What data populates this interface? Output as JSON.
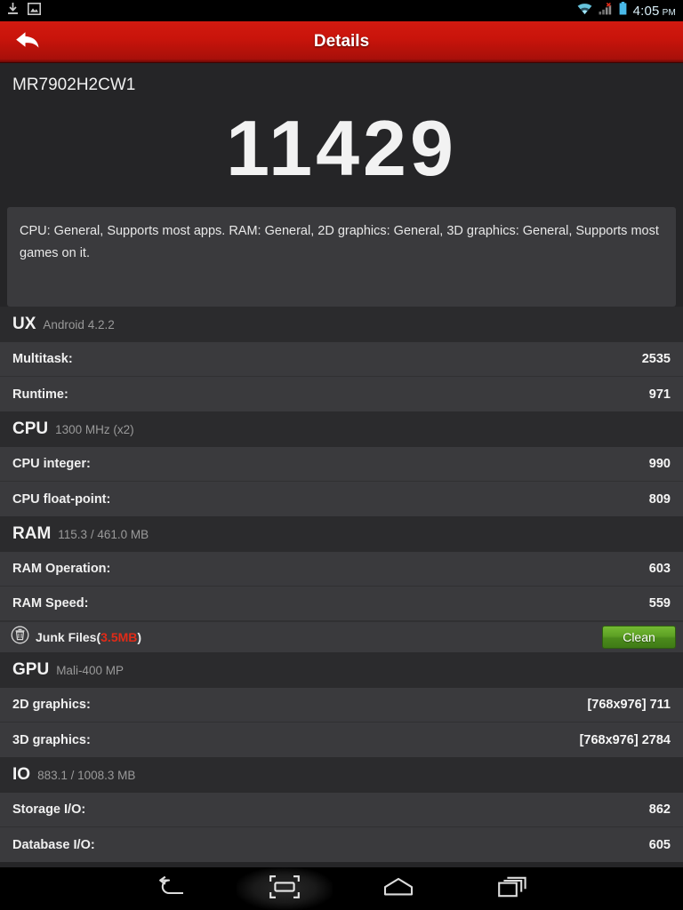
{
  "statusbar": {
    "left_icons": [
      "download-icon",
      "screenshot-image-icon"
    ],
    "right_icons": [
      "wifi-icon",
      "cellular-signal-no-service-icon",
      "battery-icon"
    ],
    "time": "4:05",
    "ampm": "PM"
  },
  "actionbar": {
    "back_icon": "back-arrow-icon",
    "title": "Details",
    "color": "#c9140b"
  },
  "main": {
    "device_name": "MR7902H2CW1",
    "score": "11429",
    "description": "CPU: General, Supports most apps. RAM: General, 2D graphics: General, 3D graphics: General, Supports most games on it."
  },
  "sections": [
    {
      "title": "UX",
      "subtitle": "Android 4.2.2",
      "rows": [
        {
          "label": "Multitask:",
          "value": "2535"
        },
        {
          "label": "Runtime:",
          "value": "971"
        }
      ]
    },
    {
      "title": "CPU",
      "subtitle": "1300 MHz (x2)",
      "rows": [
        {
          "label": "CPU integer:",
          "value": "990"
        },
        {
          "label": "CPU float-point:",
          "value": "809"
        }
      ]
    },
    {
      "title": "RAM",
      "subtitle": "115.3 / 461.0 MB",
      "rows": [
        {
          "label": "RAM Operation:",
          "value": "603"
        },
        {
          "label": "RAM Speed:",
          "value": "559"
        }
      ],
      "junk": {
        "icon": "trash-can-icon",
        "label_prefix": "Junk Files(",
        "size": "3.5MB",
        "label_suffix": ")",
        "button_label": "Clean",
        "button_color": "#5da024"
      }
    },
    {
      "title": "GPU",
      "subtitle": "Mali-400 MP",
      "rows": [
        {
          "label": "2D graphics:",
          "value": "[768x976] 711"
        },
        {
          "label": "3D graphics:",
          "value": "[768x976] 2784"
        }
      ]
    },
    {
      "title": "IO",
      "subtitle": "883.1 / 1008.3 MB",
      "rows": [
        {
          "label": "Storage I/O:",
          "value": "862"
        },
        {
          "label": "Database I/O:",
          "value": "605"
        }
      ]
    }
  ],
  "navbar": {
    "buttons": [
      {
        "name": "back",
        "icon": "nav-back-icon"
      },
      {
        "name": "screenshot",
        "icon": "nav-screenshot-icon"
      },
      {
        "name": "home",
        "icon": "nav-home-icon"
      },
      {
        "name": "recents",
        "icon": "nav-recents-icon"
      }
    ]
  }
}
